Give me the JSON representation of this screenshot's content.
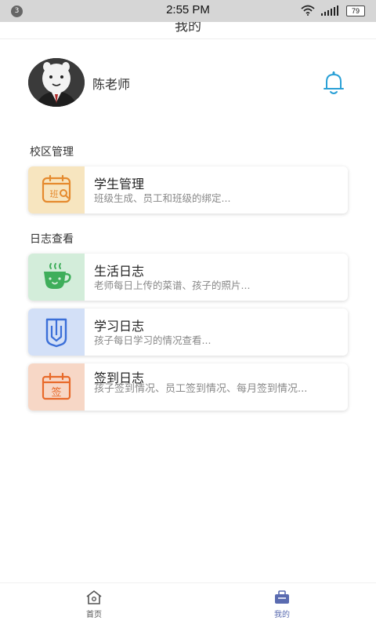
{
  "status_bar": {
    "notification_count": "3",
    "time": "2:55 PM",
    "battery": "79"
  },
  "header": {
    "title": "我的"
  },
  "profile": {
    "name": "陈老师"
  },
  "sections": {
    "campus": {
      "title": "校区管理",
      "items": [
        {
          "title": "学生管理",
          "desc": "班级生成、员工和班级的绑定...",
          "icon": "class-icon",
          "icon_bg": "#f7e5bf"
        }
      ]
    },
    "logs": {
      "title": "日志查看",
      "items": [
        {
          "title": "生活日志",
          "desc": "老师每日上传的菜谱、孩子的照片...",
          "icon": "cup-icon",
          "icon_bg": "#d3edda"
        },
        {
          "title": "学习日志",
          "desc": "孩子每日学习的情况查看...",
          "icon": "book-icon",
          "icon_bg": "#d3e0f7"
        },
        {
          "title": "签到日志",
          "desc": "孩子签到情况、员工签到情况、每月签到情况...",
          "icon": "signin-calendar-icon",
          "icon_bg": "#f7d7c6"
        }
      ]
    }
  },
  "tabbar": {
    "home": "首页",
    "mine": "我的"
  },
  "colors": {
    "accent": "#2aa0d6",
    "tab_active": "#5a6bb0",
    "tab_inactive": "#555555"
  }
}
